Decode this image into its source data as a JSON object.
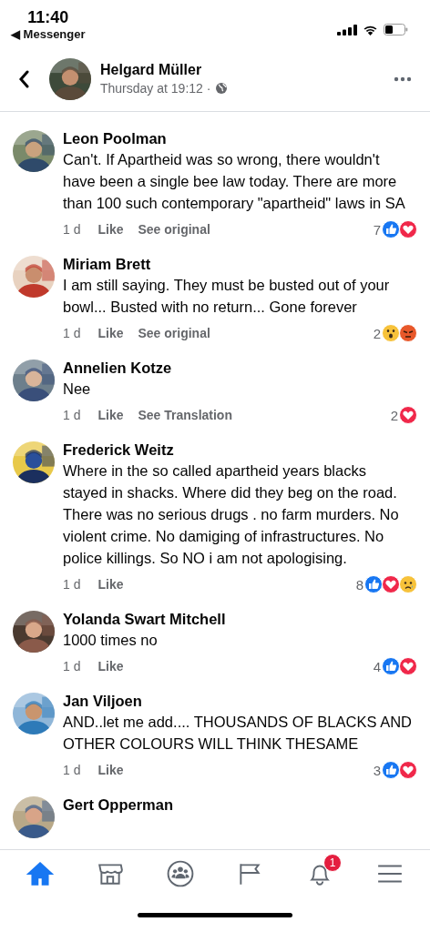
{
  "status_bar": {
    "time": "11:40",
    "back_app": "◀ Messenger"
  },
  "header": {
    "name": "Helgard Müller",
    "subtitle": "Thursday at 19:12 ·"
  },
  "comments": [
    {
      "name": "Leon Poolman",
      "text": "Can't. If Apartheid was so wrong, there wouldn't have been a single bee law today. There are more than 100 such contemporary \"apartheid\" laws in SA",
      "time": "1 d",
      "like": "Like",
      "action": "See original",
      "count": "7",
      "reactions": [
        {
          "kind": "like"
        },
        {
          "kind": "love"
        }
      ]
    },
    {
      "name": "Miriam Brett",
      "text": "I am still saying. They must be busted out of your bowl... Busted with no return... Gone forever",
      "time": "1 d",
      "like": "Like",
      "action": "See original",
      "count": "2",
      "reactions": [
        {
          "kind": "wow"
        },
        {
          "kind": "angry"
        }
      ]
    },
    {
      "name": "Annelien Kotze",
      "text": "Nee",
      "time": "1 d",
      "like": "Like",
      "action": "See Translation",
      "count": "2",
      "reactions": [
        {
          "kind": "love"
        }
      ]
    },
    {
      "name": "Frederick Weitz",
      "text": "Where in the so called apartheid years blacks stayed in shacks. Where did they beg on the road. There was no serious drugs . no farm murders. No violent crime. No damiging of infrastructures. No police killings. So NO i am not apologising.",
      "time": "1 d",
      "like": "Like",
      "count": "8",
      "reactions": [
        {
          "kind": "like"
        },
        {
          "kind": "love"
        },
        {
          "kind": "sad"
        }
      ]
    },
    {
      "name": "Yolanda Swart Mitchell",
      "text": "1000 times no",
      "time": "1 d",
      "like": "Like",
      "count": "4",
      "reactions": [
        {
          "kind": "like"
        },
        {
          "kind": "love"
        }
      ]
    },
    {
      "name": "Jan Viljoen",
      "text": "AND..let me add.... THOUSANDS OF BLACKS AND OTHER COLOURS  WILL THINK THESAME",
      "time": "1 d",
      "like": "Like",
      "count": "3",
      "reactions": [
        {
          "kind": "like"
        },
        {
          "kind": "love"
        }
      ]
    },
    {
      "name": "Gert Opperman"
    }
  ],
  "nav": [
    {
      "kind": "home",
      "selected": true
    },
    {
      "kind": "marketplace",
      "selected": false
    },
    {
      "kind": "groups",
      "selected": false
    },
    {
      "kind": "pages",
      "selected": false
    },
    {
      "kind": "notifications",
      "selected": false,
      "badge": "1"
    },
    {
      "kind": "menu",
      "selected": false
    }
  ]
}
